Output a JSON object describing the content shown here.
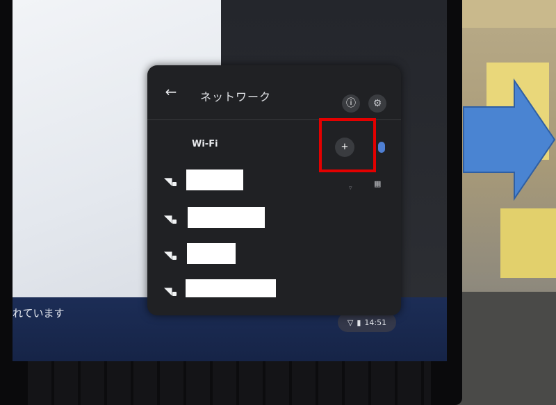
{
  "panel": {
    "title": "ネットワーク",
    "back_icon": "←",
    "info_icon": "ⓘ",
    "settings_icon": "⚙",
    "wifi_label": "Wi-Fi",
    "add_network_icon": "+",
    "networks": [
      {
        "name": "",
        "icon": "wifi-locked-icon"
      },
      {
        "name": "",
        "icon": "wifi-locked-icon"
      },
      {
        "name": "",
        "icon": "wifi-locked-icon"
      },
      {
        "name": "",
        "icon": "wifi-locked-icon"
      }
    ]
  },
  "taskbar": {
    "notice_text": "れています",
    "clock": "14:51"
  },
  "annotation": {
    "highlight_color": "#e30000",
    "arrow_color": "#4a84d2"
  }
}
